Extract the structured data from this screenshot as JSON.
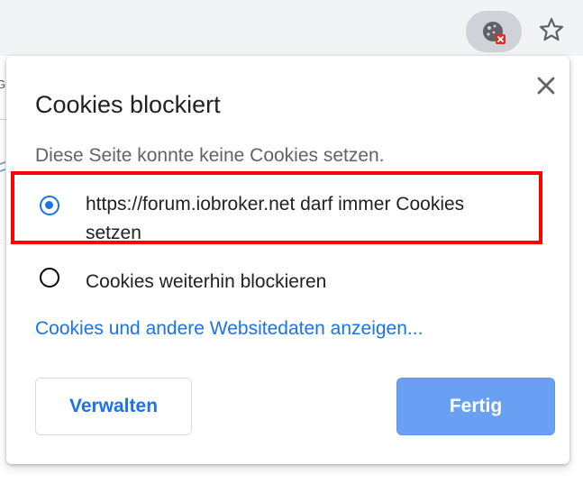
{
  "popup": {
    "title": "Cookies blockiert",
    "subtitle": "Diese Seite konnte keine Cookies setzen.",
    "options": [
      {
        "label_line1": "https://forum.iobroker.net darf immer Cookies",
        "label_line2": "setzen",
        "selected": true
      },
      {
        "label": "Cookies weiterhin blockieren",
        "selected": false
      }
    ],
    "link": "Cookies und andere Websitedaten anzeigen...",
    "buttons": {
      "manage": "Verwalten",
      "done": "Fertig"
    }
  },
  "toolbar": {
    "cookie_icon": "cookie-blocked-icon",
    "bookmark_icon": "star-icon"
  },
  "colors": {
    "accent": "#1a73e8",
    "highlight_border": "#ff0000",
    "done_button": "#6aa0f3"
  }
}
